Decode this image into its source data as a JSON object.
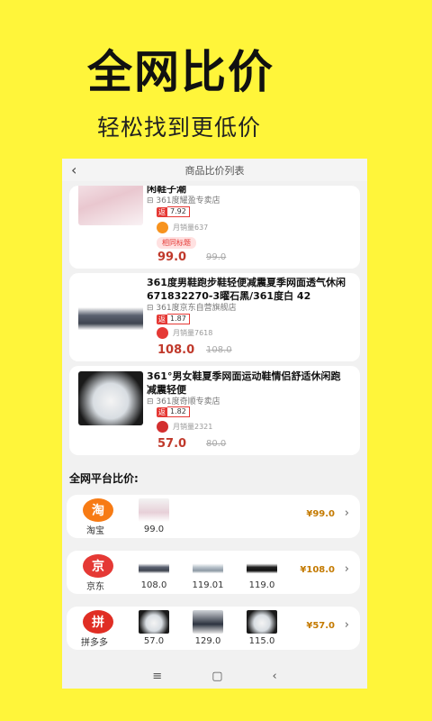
{
  "hero": {
    "title": "全网比价",
    "subtitle": "轻松找到更低价"
  },
  "topbar": {
    "back_icon": "‹",
    "title": "商品比价列表"
  },
  "products": [
    {
      "title": "闲鞋子潮",
      "shop": "361度耀盈专卖店",
      "rebate_tag": "返",
      "rebate": "7.92",
      "sales": "月销量637",
      "badge": "相同标题",
      "price": "99.0",
      "original_price": "99.0",
      "platform_color": "#F7931E"
    },
    {
      "title": "361度男鞋跑步鞋轻便减震夏季网面透气休闲\n671832270-3曜石黑/361度白 42",
      "shop": "361度京东自营旗舰店",
      "rebate_tag": "返",
      "rebate": "1.87",
      "sales": "月销量7618",
      "price": "108.0",
      "original_price": "108.0",
      "platform_color": "#E53935"
    },
    {
      "title": "361°男女鞋夏季网面运动鞋情侣舒适休闲跑\n减震轻便",
      "shop": "361度奇顺专卖店",
      "rebate_tag": "返",
      "rebate": "1.82",
      "sales": "月销量2321",
      "price": "57.0",
      "original_price": "80.0",
      "platform_color": "#D32F2F"
    }
  ],
  "platform_section": {
    "title": "全网平台比价:"
  },
  "platforms": [
    {
      "name": "淘宝",
      "logo_text": "淘",
      "logo_color": "#F77B14",
      "best_price": "¥99.0",
      "items": [
        "99.0"
      ]
    },
    {
      "name": "京东",
      "logo_text": "京",
      "logo_color": "#E53935",
      "best_price": "¥108.0",
      "items": [
        "108.0",
        "119.01",
        "119.0"
      ]
    },
    {
      "name": "拼多多",
      "logo_text": "拼",
      "logo_color": "#E02E24",
      "best_price": "¥57.0",
      "items": [
        "57.0",
        "129.0",
        "115.0"
      ]
    }
  ],
  "navbar": {
    "menu_icon": "≡",
    "home_icon": "▢",
    "back_icon": "‹"
  }
}
